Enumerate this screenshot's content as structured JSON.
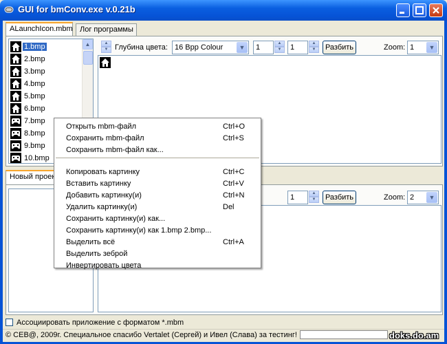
{
  "window": {
    "title": "GUI for bmConv.exe v.0.21b"
  },
  "tabs": [
    {
      "label": "ALaunchIcon.mbm",
      "active": true
    },
    {
      "label": "Лог программы",
      "active": false
    }
  ],
  "bottom_tab": {
    "label": "Новый проект"
  },
  "file_list": {
    "items": [
      "1.bmp",
      "2.bmp",
      "3.bmp",
      "4.bmp",
      "5.bmp",
      "6.bmp",
      "7.bmp",
      "8.bmp",
      "9.bmp",
      "10.bmp"
    ],
    "selected": "1.bmp"
  },
  "top_toolbar": {
    "depth_label": "Глубина цвета:",
    "depth_value": "16 Bpp Colour",
    "spin1": "1",
    "spin2": "1",
    "split_button": "Разбить",
    "zoom_label": "Zoom:",
    "zoom_value": "1"
  },
  "bottom_toolbar": {
    "spin2": "1",
    "split_button": "Разбить",
    "zoom_label": "Zoom:",
    "zoom_value": "2"
  },
  "context_menu": {
    "items": [
      {
        "label": "Открыть mbm-файл",
        "shortcut": "Ctrl+O"
      },
      {
        "label": "Сохранить mbm-файл",
        "shortcut": "Ctrl+S"
      },
      {
        "label": "Сохранить mbm-файл как...",
        "shortcut": ""
      },
      {
        "label": "Копировать картинку",
        "shortcut": "Ctrl+C"
      },
      {
        "label": "Вставить картинку",
        "shortcut": "Ctrl+V"
      },
      {
        "label": "Добавить картинку(и)",
        "shortcut": "Ctrl+N"
      },
      {
        "label": "Удалить картинку(и)",
        "shortcut": "Del"
      },
      {
        "label": "Сохранить картинку(и) как...",
        "shortcut": ""
      },
      {
        "label": "Сохранить картинку(и) как 1.bmp 2.bmp...",
        "shortcut": ""
      },
      {
        "label": "Выделить всё",
        "shortcut": "Ctrl+A"
      },
      {
        "label": "Выделить зеброй",
        "shortcut": ""
      },
      {
        "label": "Инвертировать цвета",
        "shortcut": ""
      }
    ]
  },
  "associate": {
    "label": "Ассоциировать приложение с форматом *.mbm",
    "checked": false
  },
  "status": {
    "text": "© CEB@, 2009г. Специальное спасибо Vertalet (Сергей) и Ивел (Слава) за тестинг!"
  },
  "watermark": "doks.do.am",
  "colors": {
    "titlebar": "#0653d6",
    "selection": "#316ac5",
    "tab_accent": "#f7a52c"
  }
}
